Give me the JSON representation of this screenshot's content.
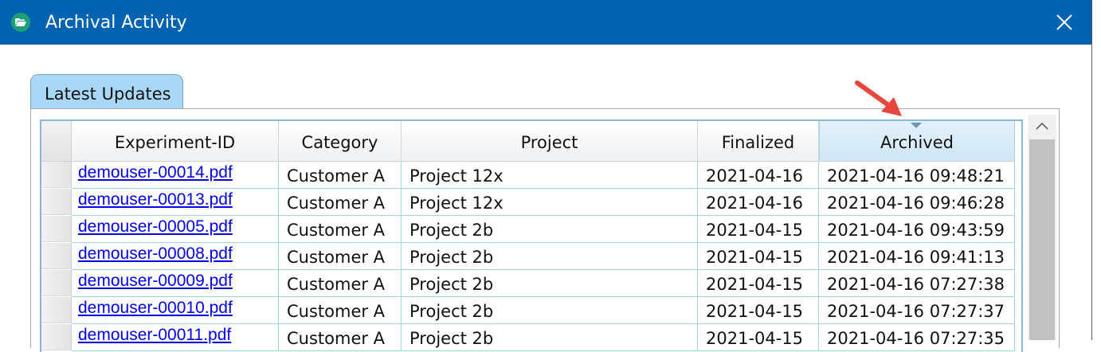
{
  "window": {
    "title": "Archival Activity",
    "app_icon": "folder-open-icon",
    "close_icon": "close-icon",
    "accent_color": "#0063b1"
  },
  "tabs": [
    {
      "label": "Latest Updates",
      "selected": true
    }
  ],
  "table": {
    "columns": [
      "Experiment-ID",
      "Category",
      "Project",
      "Finalized",
      "Archived"
    ],
    "sorted_column": "Archived",
    "sort_direction": "descending",
    "rows": [
      [
        "demouser-00014.pdf",
        "Customer A",
        "Project 12x",
        "2021-04-16",
        "2021-04-16 09:48:21"
      ],
      [
        "demouser-00013.pdf",
        "Customer A",
        "Project 12x",
        "2021-04-16",
        "2021-04-16 09:46:28"
      ],
      [
        "demouser-00005.pdf",
        "Customer A",
        "Project 2b",
        "2021-04-15",
        "2021-04-16 09:43:59"
      ],
      [
        "demouser-00008.pdf",
        "Customer A",
        "Project 2b",
        "2021-04-15",
        "2021-04-16 09:41:13"
      ],
      [
        "demouser-00009.pdf",
        "Customer A",
        "Project 2b",
        "2021-04-15",
        "2021-04-16 07:27:38"
      ],
      [
        "demouser-00010.pdf",
        "Customer A",
        "Project 2b",
        "2021-04-15",
        "2021-04-16 07:27:37"
      ],
      [
        "demouser-00011.pdf",
        "Customer A",
        "Project 2b",
        "2021-04-15",
        "2021-04-16 07:27:35"
      ]
    ]
  },
  "annotation": {
    "icon": "red-pointer-arrow-icon",
    "color": "#e8463c"
  },
  "scrollbar": {
    "up_icon": "chevron-up-icon"
  }
}
